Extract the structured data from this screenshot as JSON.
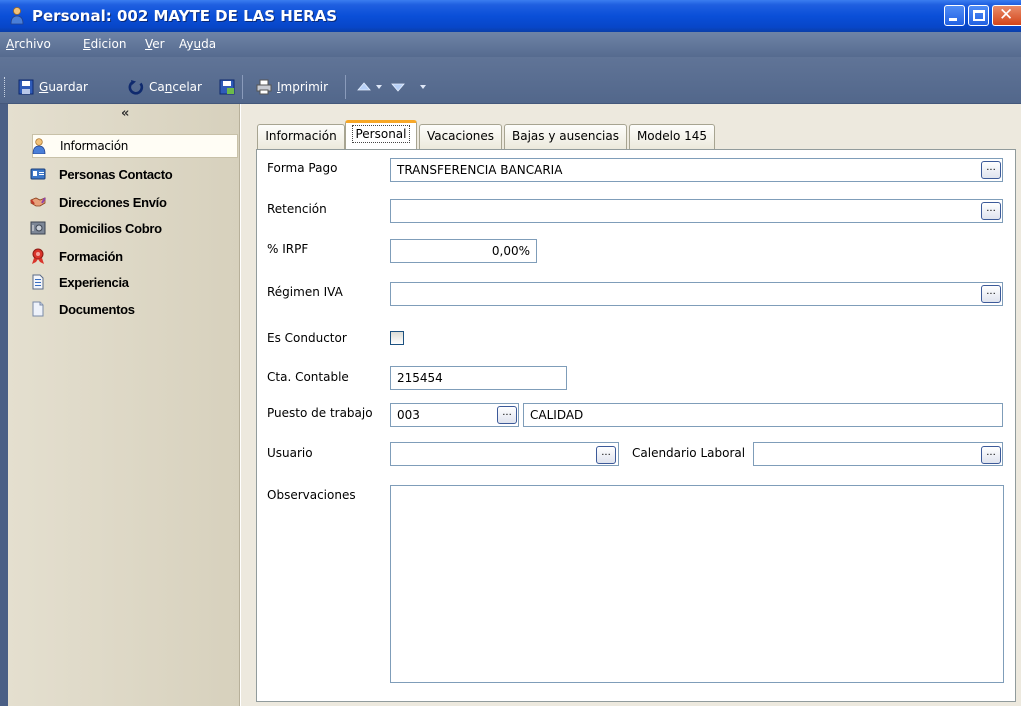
{
  "window": {
    "title": "Personal: 002 MAYTE DE LAS HERAS"
  },
  "menu": [
    {
      "label": "Archivo",
      "mnemonic": "A",
      "rest": "rchivo"
    },
    {
      "label": "Edicion",
      "mnemonic": "E",
      "rest": "dicion"
    },
    {
      "label": "Ver",
      "mnemonic": "V",
      "rest": "er"
    },
    {
      "label": "Ayuda",
      "pre": "Ay",
      "mnemonic": "u",
      "rest": "da"
    }
  ],
  "toolbar": {
    "save_pre": "",
    "save_mn": "G",
    "save_rest": "uardar",
    "cancel_pre": "Ca",
    "cancel_mn": "n",
    "cancel_rest": "celar",
    "print_pre": "",
    "print_mn": "I",
    "print_rest": "mprimir"
  },
  "sidebar": {
    "collapse_glyph": "«",
    "items": [
      {
        "label": "Información",
        "icon": "person-icon",
        "active": true
      },
      {
        "label": "Personas Contacto",
        "icon": "contact-card-icon"
      },
      {
        "label": "Direcciones Envío",
        "icon": "handshake-icon"
      },
      {
        "label": "Domicilios Cobro",
        "icon": "safe-icon"
      },
      {
        "label": "Formación",
        "icon": "ribbon-icon"
      },
      {
        "label": "Experiencia",
        "icon": "document-icon"
      },
      {
        "label": "Documentos",
        "icon": "page-icon"
      }
    ]
  },
  "tabs": [
    {
      "label": "Información"
    },
    {
      "label": "Personal",
      "active": true
    },
    {
      "label": "Vacaciones"
    },
    {
      "label": "Bajas y ausencias"
    },
    {
      "label": "Modelo 145"
    }
  ],
  "form": {
    "forma_pago": {
      "label": "Forma Pago",
      "value": "TRANSFERENCIA BANCARIA"
    },
    "retencion": {
      "label": "Retención",
      "value": ""
    },
    "irpf": {
      "label": "% IRPF",
      "value": "0,00%"
    },
    "regimen_iva": {
      "label": "Régimen IVA",
      "value": ""
    },
    "es_conductor": {
      "label": "Es Conductor",
      "checked": false
    },
    "cta_contable": {
      "label": "Cta. Contable",
      "value": "215454"
    },
    "puesto": {
      "label": "Puesto de trabajo",
      "code": "003",
      "name": "CALIDAD"
    },
    "usuario": {
      "label": "Usuario",
      "value": ""
    },
    "calendario": {
      "label": "Calendario Laboral",
      "value": ""
    },
    "observaciones": {
      "label": "Observaciones",
      "value": ""
    },
    "ellipsis": "..."
  }
}
